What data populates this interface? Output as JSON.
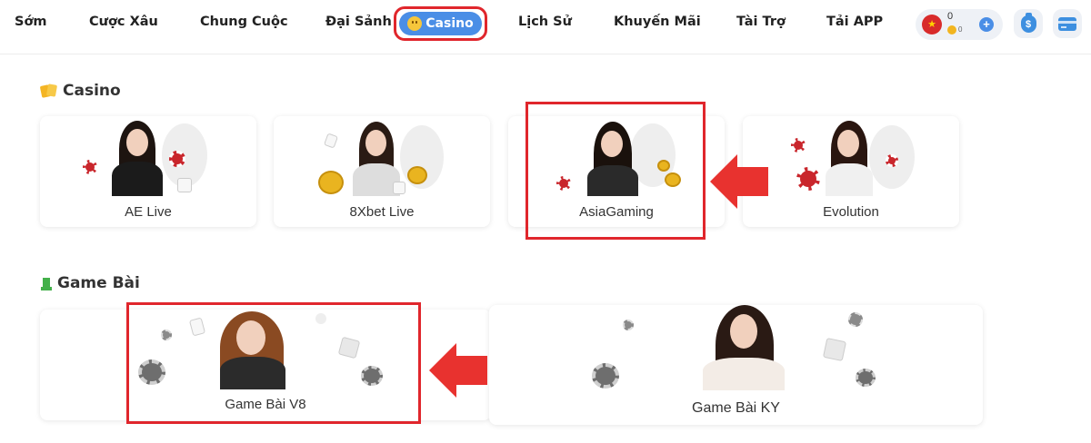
{
  "nav": {
    "items": [
      "Sớm",
      "Cược Xâu",
      "Chung Cuộc",
      "Đại Sảnh"
    ],
    "active": "Casino",
    "items_right": [
      "Lịch Sử",
      "Khuyến Mãi",
      "Tài Trợ",
      "Tải APP"
    ]
  },
  "balance": {
    "flag_icon": "vietnam-flag-icon",
    "main": "0",
    "coins": "0"
  },
  "sections": {
    "casino": {
      "title": "Casino",
      "icon": "cards-icon"
    },
    "gamebai": {
      "title": "Game Bài",
      "icon": "rook-icon"
    }
  },
  "casino_cards": [
    "AE Live",
    "8Xbet Live",
    "AsiaGaming",
    "Evolution"
  ],
  "gamebai_cards": [
    "Game Bài V8",
    "Game Bài KY"
  ],
  "colors": {
    "accent": "#e0262c",
    "active_pill": "#4a8ee6",
    "nav_text": "#222222"
  }
}
